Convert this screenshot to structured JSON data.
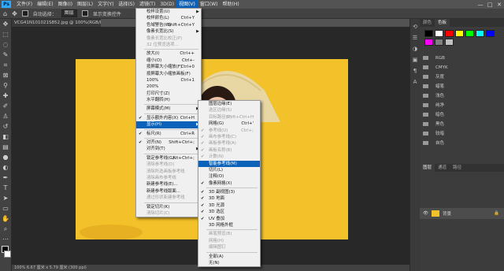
{
  "app": {
    "logo": "Ps",
    "menus": [
      "文件(F)",
      "编辑(E)",
      "图像(I)",
      "图层(L)",
      "文字(Y)",
      "选择(S)",
      "滤镜(T)",
      "3D(D)",
      "视图(V)",
      "窗口(W)",
      "帮助(H)"
    ],
    "active_menu_index": 8,
    "window_controls": [
      "—",
      "□",
      "✕"
    ]
  },
  "options_bar": {
    "auto_select_label": "自动选择：",
    "auto_select_value": "图层",
    "show_transform_label": "显示变换控件"
  },
  "document": {
    "tab_title": "VCG41N101021S852.jpg @ 100%(RGB/8)",
    "status": "100%   6.67 厘米 x 5.79 厘米 (300 ppi)"
  },
  "view_menu": [
    {
      "label": "校样设置(U)",
      "arrow": true
    },
    {
      "label": "校样颜色(L)",
      "shortcut": "Ctrl+Y"
    },
    {
      "label": "色域警告(W)",
      "shortcut": "Shift+Ctrl+Y"
    },
    {
      "label": "像素长宽比(S)",
      "arrow": true
    },
    {
      "label": "像素长宽比校正(P)",
      "disabled": true
    },
    {
      "label": "32 位预览选项...",
      "disabled": true
    },
    {
      "sep": true
    },
    {
      "label": "放大(I)",
      "shortcut": "Ctrl++"
    },
    {
      "label": "缩小(O)",
      "shortcut": "Ctrl+-"
    },
    {
      "label": "按屏幕大小缩放(F)",
      "shortcut": "Ctrl+0"
    },
    {
      "label": "按屏幕大小缩放画板(F)"
    },
    {
      "label": "100%",
      "shortcut": "Ctrl+1"
    },
    {
      "label": "200%"
    },
    {
      "label": "打印尺寸(Z)"
    },
    {
      "label": "水平翻转(H)"
    },
    {
      "sep": true
    },
    {
      "label": "屏幕模式(M)",
      "arrow": true
    },
    {
      "sep": true
    },
    {
      "label": "显示额外内容(X)",
      "shortcut": "Ctrl+H",
      "check": true
    },
    {
      "label": "显示(H)",
      "arrow": true,
      "highlight": true
    },
    {
      "sep": true
    },
    {
      "label": "标尺(R)",
      "shortcut": "Ctrl+R",
      "check": true
    },
    {
      "sep": true
    },
    {
      "label": "对齐(N)",
      "shortcut": "Shift+Ctrl+;",
      "check": true
    },
    {
      "label": "对齐到(T)",
      "arrow": true
    },
    {
      "sep": true
    },
    {
      "label": "锁定参考线(G)",
      "shortcut": "Alt+Ctrl+;"
    },
    {
      "label": "清除参考线(D)",
      "disabled": true
    },
    {
      "label": "清除所选画板参考线",
      "disabled": true
    },
    {
      "label": "清除画布参考线",
      "disabled": true
    },
    {
      "label": "新建参考线(E)..."
    },
    {
      "label": "新建参考线版面..."
    },
    {
      "label": "通过形状新建参考线",
      "disabled": true
    },
    {
      "sep": true
    },
    {
      "label": "锁定切片(K)"
    },
    {
      "label": "清除切片(C)",
      "disabled": true
    }
  ],
  "show_submenu": [
    {
      "label": "图层边缘(E)"
    },
    {
      "label": "选区边缘(S)",
      "disabled": true
    },
    {
      "label": "目标路径(P)",
      "shortcut": "Shift+Ctrl+H",
      "disabled": true
    },
    {
      "label": "网格(G)",
      "shortcut": "Ctrl+'"
    },
    {
      "label": "参考线(U)",
      "shortcut": "Ctrl+;",
      "check": true,
      "disabled": true
    },
    {
      "label": "画布参考线(C)",
      "check": true,
      "disabled": true
    },
    {
      "label": "画板参考线(A)",
      "check": true,
      "disabled": true
    },
    {
      "label": "画板名称(B)",
      "check": true,
      "disabled": true
    },
    {
      "label": "计数(N)",
      "check": true,
      "disabled": true
    },
    {
      "label": "智能参考线(M)",
      "highlight": true
    },
    {
      "label": "切片(L)"
    },
    {
      "label": "注释(O)"
    },
    {
      "label": "像素网格(X)",
      "check": true
    },
    {
      "sep": true
    },
    {
      "label": "3D 副视图(3)",
      "check": true
    },
    {
      "label": "3D 地面",
      "check": true
    },
    {
      "label": "3D 光源",
      "check": true
    },
    {
      "label": "3D 选区",
      "check": true
    },
    {
      "label": "UV 叠加",
      "check": true
    },
    {
      "label": "3D 网格外框"
    },
    {
      "sep": true
    },
    {
      "label": "画笔预览(B)",
      "disabled": true
    },
    {
      "label": "网格(H)",
      "disabled": true
    },
    {
      "label": "编辑图钉",
      "disabled": true
    },
    {
      "sep": true
    },
    {
      "label": "全部(A)"
    },
    {
      "label": "无(N)"
    }
  ],
  "right_panel": {
    "tabs": [
      "颜色",
      "色板"
    ],
    "active_tab": 1,
    "swatch_colors": [
      "#000000",
      "#ffffff",
      "#ff0000",
      "#ffff00",
      "#00ff00",
      "#00ffff",
      "#0000ff",
      "#ff00ff",
      "#7f7f7f",
      "#c0c0c0"
    ],
    "folders": [
      "RGB",
      "CMYK",
      "灰度",
      "蜡笔",
      "浅色",
      "纯净",
      "暗色",
      "黑色",
      "较暗",
      "自色"
    ],
    "layer_tabs": [
      "图层",
      "通道",
      "路径"
    ],
    "layer_name": "背景"
  }
}
